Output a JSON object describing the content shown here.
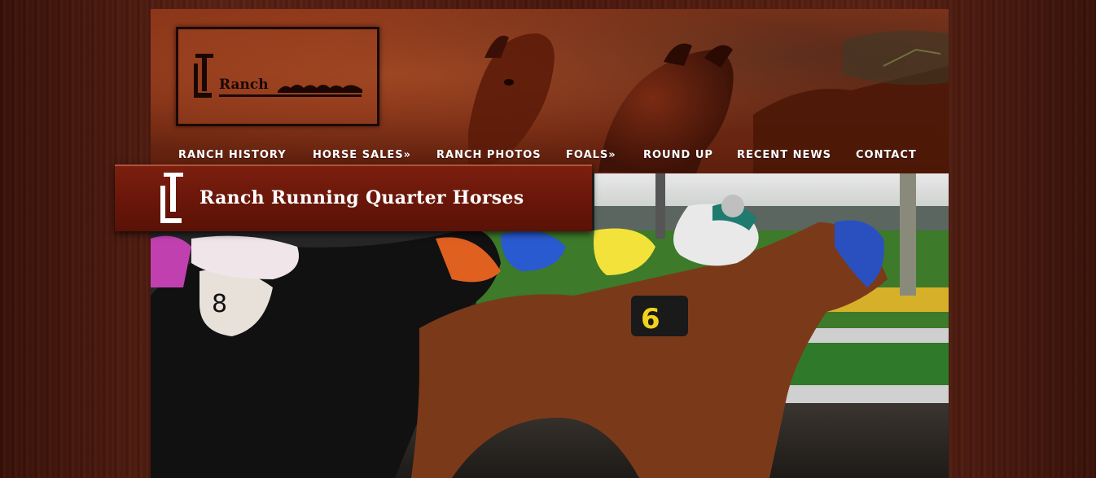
{
  "logo": {
    "text": "Ranch"
  },
  "nav": {
    "items": [
      {
        "label": "RANCH HISTORY"
      },
      {
        "label": "HORSE SALES»"
      },
      {
        "label": "RANCH PHOTOS"
      },
      {
        "label": "FOALS»"
      },
      {
        "label": "ROUND UP"
      },
      {
        "label": "RECENT NEWS"
      },
      {
        "label": "CONTACT"
      }
    ]
  },
  "banner": {
    "title": "Ranch Running Quarter Horses"
  },
  "colors": {
    "background": "#4a1a10",
    "header": "#7a2c14",
    "banner": "#6a170a",
    "nav_text": "#ffffff"
  },
  "icons": {
    "logo_mark": "jl-brand-icon",
    "banner_mark": "jl-brand-icon"
  }
}
